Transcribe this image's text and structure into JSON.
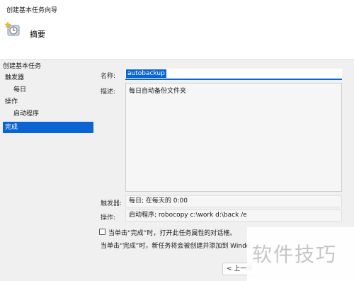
{
  "window": {
    "title": "创建基本任务向导"
  },
  "header": {
    "heading": "摘要",
    "icon": "wizard-clock-icon"
  },
  "sidebar": {
    "steps": [
      {
        "label": "创建基本任务"
      },
      {
        "label": "触发器"
      },
      {
        "label": "每日"
      },
      {
        "label": "操作"
      },
      {
        "label": "启动程序"
      },
      {
        "label": "完成"
      }
    ],
    "active_step": "完成"
  },
  "summary": {
    "name_label": "名称:",
    "name_value": "autobackup",
    "desc_label": "描述:",
    "desc_value": "每日自动备份文件夹",
    "trigger_label": "触发器:",
    "trigger_value": "每日; 在每天的 0:00",
    "action_label": "操作:",
    "action_value": "启动程序; robocopy c:\\work d:\\back /e",
    "checkbox_label": "当单击“完成”时，打开此任务属性的对话框。",
    "checkbox_checked": false,
    "note": "当单击“完成”时，新任务将会被创建并添加到 Windo"
  },
  "footer": {
    "back_button": "< 上一步"
  },
  "watermark": "软件技巧",
  "colors": {
    "accent": "#0a64d1"
  }
}
